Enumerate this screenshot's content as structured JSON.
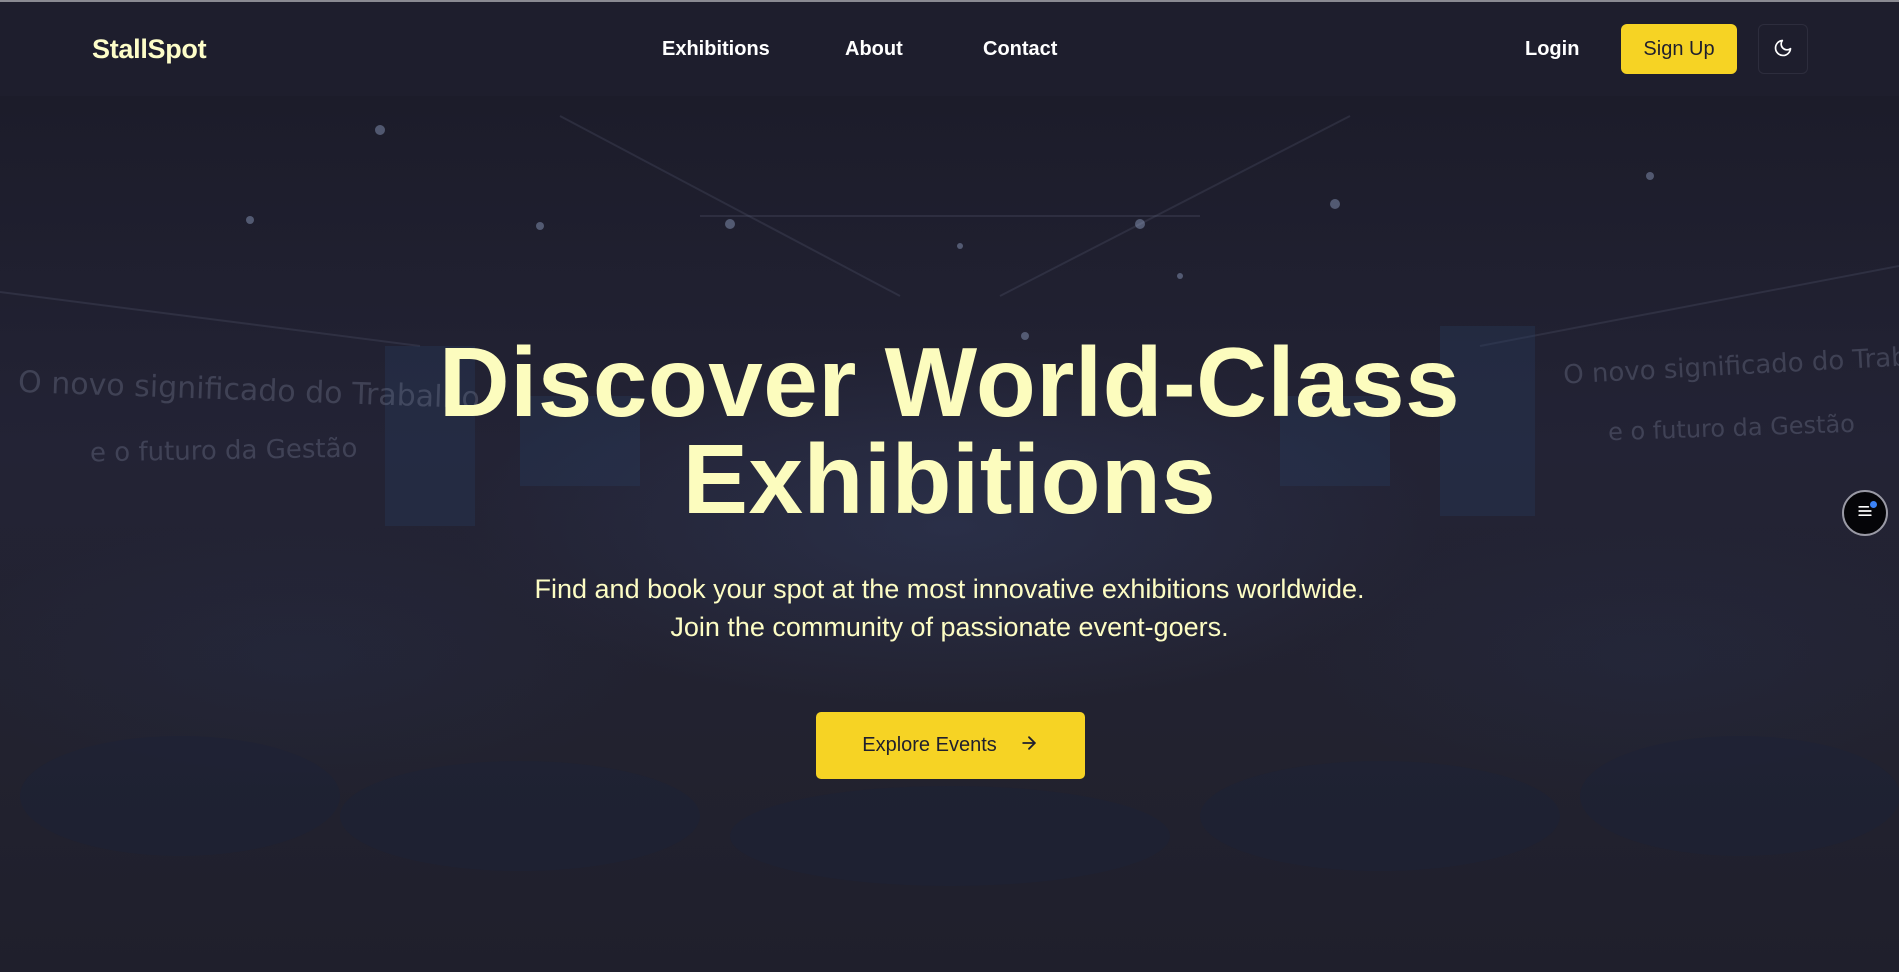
{
  "header": {
    "brand": "StallSpot",
    "nav": [
      {
        "label": "Exhibitions"
      },
      {
        "label": "About"
      },
      {
        "label": "Contact"
      }
    ],
    "login_label": "Login",
    "signup_label": "Sign Up",
    "theme_toggle_icon": "moon-icon"
  },
  "background": {
    "left_banner_line1": "O novo significado do Trabalho",
    "left_banner_line2": "e o futuro da Gestão",
    "right_banner_line1": "O novo significado do Trabalho",
    "right_banner_line2": "e o futuro da Gestão"
  },
  "hero": {
    "title_line1": "Discover World-Class",
    "title_line2": "Exhibitions",
    "subtitle_line1": "Find and book your spot at the most innovative exhibitions worldwide.",
    "subtitle_line2": "Join the community of passionate event-goers.",
    "cta_label": "Explore Events",
    "cta_icon": "arrow-right-icon"
  },
  "floating_button": {
    "icon": "menu-icon"
  },
  "colors": {
    "accent": "#f6d324",
    "background": "#1f1f2e",
    "title": "#fcfcbe",
    "notification_dot": "#3b82f6"
  }
}
